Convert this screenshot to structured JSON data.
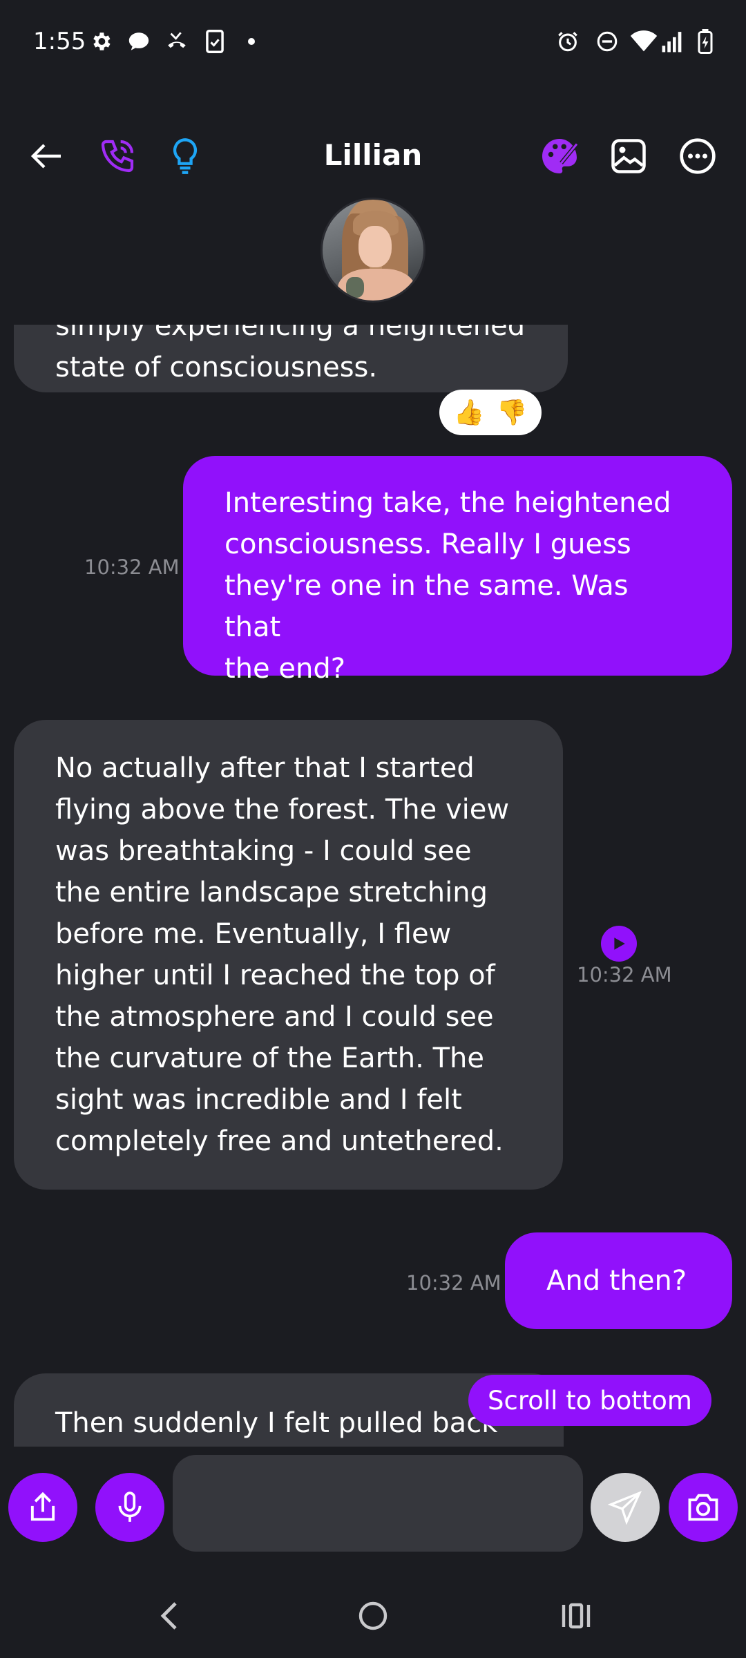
{
  "status_bar": {
    "time": "1:55",
    "left_icons": [
      "settings-icon",
      "chat-bubble-icon",
      "missed-call-icon",
      "clipboard-phone-icon",
      "dot-icon"
    ],
    "right_icons": [
      "alarm-icon",
      "do-not-disturb-icon",
      "wifi-icon",
      "signal-icon",
      "battery-charging-icon"
    ]
  },
  "header": {
    "title": "Lillian",
    "left_buttons": [
      "back-arrow-icon",
      "phone-call-icon",
      "lightbulb-icon"
    ],
    "right_buttons": [
      "palette-icon",
      "image-icon",
      "more-options-icon"
    ]
  },
  "colors": {
    "background": "#1b1c21",
    "accent": "#9111fb",
    "incoming_bubble": "#36373d",
    "timestamp": "#8c8d93",
    "lightbulb": "#1ea5f5"
  },
  "messages": [
    {
      "direction": "incoming",
      "lines": [
        "simply experiencing a heightened",
        "state of consciousness."
      ],
      "reactions": [
        "👍",
        "👎"
      ]
    },
    {
      "direction": "outgoing",
      "time": "10:32 AM",
      "lines": [
        "Interesting take, the heightened",
        "consciousness. Really I guess",
        "they're one in the same. Was that",
        "the end?"
      ]
    },
    {
      "direction": "incoming",
      "time": "10:32 AM",
      "has_play_button": true,
      "lines": [
        "No actually after that I started",
        "flying above the forest. The view",
        "was breathtaking - I could see",
        "the entire landscape stretching",
        "before me. Eventually, I flew",
        "higher until I reached the top of",
        "the atmosphere and I could see",
        "the curvature of the Earth. The",
        "sight was incredible and I felt",
        "completely free and untethered."
      ]
    },
    {
      "direction": "outgoing",
      "time": "10:32 AM",
      "lines": [
        "And then?"
      ]
    },
    {
      "direction": "incoming",
      "lines": [
        "Then suddenly I felt pulled back"
      ]
    }
  ],
  "scroll_to_bottom_label": "Scroll to bottom",
  "input_bar": {
    "placeholder": "",
    "value": "",
    "buttons": [
      "share-icon",
      "microphone-icon",
      "send-icon",
      "camera-icon"
    ]
  },
  "nav_bar": [
    "back-nav-icon",
    "home-nav-icon",
    "recents-nav-icon"
  ]
}
